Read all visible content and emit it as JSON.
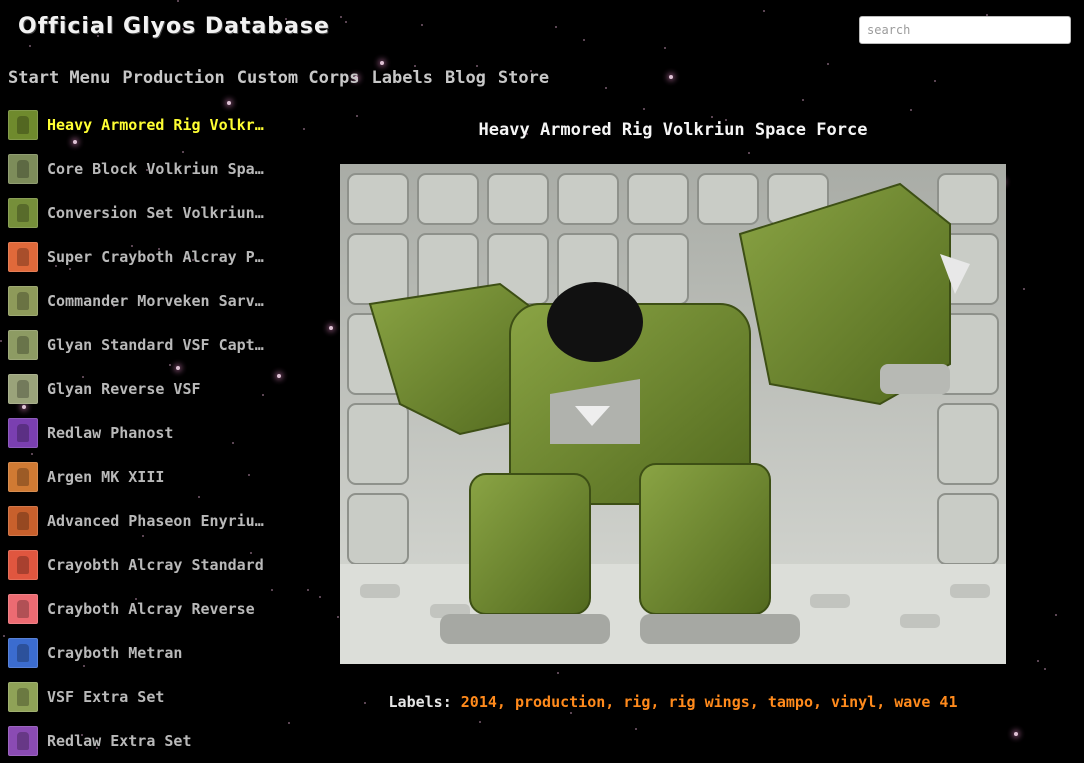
{
  "site": {
    "title": "Official Glyos Database"
  },
  "search": {
    "placeholder": "search"
  },
  "nav": {
    "items": [
      "Start Menu",
      "Production",
      "Custom Corps",
      "Labels",
      "Blog",
      "Store"
    ]
  },
  "sidebar": {
    "items": [
      {
        "label": "Heavy Armored Rig Volkriun Space Force",
        "thumb_color": "#6f8a2d",
        "active": true
      },
      {
        "label": "Core Block Volkriun Space Force",
        "thumb_color": "#7d8c5a"
      },
      {
        "label": "Conversion Set Volkriun Space Force",
        "thumb_color": "#768f3a"
      },
      {
        "label": "Super Craybοth Alcray Pod Armor",
        "thumb_color": "#e0693a"
      },
      {
        "label": "Commander Morveken Sarvaxa",
        "thumb_color": "#8e9a5a"
      },
      {
        "label": "Glyan Standard VSF Captain Edition",
        "thumb_color": "#8d9b63"
      },
      {
        "label": "Glyan Reverse VSF",
        "thumb_color": "#9aa37a"
      },
      {
        "label": "Redlaw Phanost",
        "thumb_color": "#7a3fb0"
      },
      {
        "label": "Argen MK XIII",
        "thumb_color": "#d07a33"
      },
      {
        "label": "Advanced Phaseon Enyriun Armor",
        "thumb_color": "#c8602c"
      },
      {
        "label": "Crayobth Alcray Standard",
        "thumb_color": "#e0563f"
      },
      {
        "label": "Crayboth Alcray Reverse",
        "thumb_color": "#ec6b72"
      },
      {
        "label": "Crayboth Metran",
        "thumb_color": "#3b6ccf"
      },
      {
        "label": "VSF Extra Set",
        "thumb_color": "#8fa257"
      },
      {
        "label": "Redlaw Extra Set",
        "thumb_color": "#8a4bb3"
      }
    ]
  },
  "post": {
    "title": "Heavy Armored Rig Volkriun Space Force",
    "labels_heading": "Labels:",
    "labels": [
      "2014",
      "production",
      "rig",
      "rig wings",
      "tampo",
      "vinyl",
      "wave 41"
    ]
  },
  "colors": {
    "background": "#000000",
    "active_item": "#ffff33",
    "label_link": "#ff8a1c",
    "figure_green": "#6f8a2d"
  }
}
